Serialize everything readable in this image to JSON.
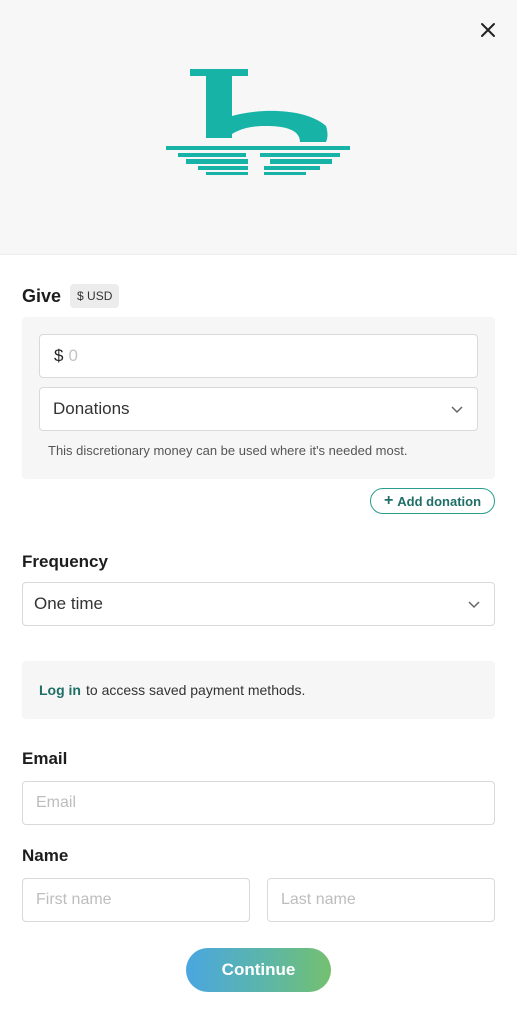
{
  "header": {
    "close_icon": "close-icon",
    "logo_icon": "church-logo",
    "brand_color": "#17b3a6"
  },
  "give": {
    "title": "Give",
    "currency_badge": "$ USD",
    "amount_symbol": "$",
    "amount_placeholder": "0",
    "fund_selected": "Donations",
    "fund_description": "This discretionary money can be used where it's needed most.",
    "add_donation_label": "Add donation"
  },
  "frequency": {
    "label": "Frequency",
    "selected": "One time"
  },
  "login_notice": {
    "link_text": "Log in",
    "text": "to access saved payment methods."
  },
  "email": {
    "label": "Email",
    "placeholder": "Email"
  },
  "name": {
    "label": "Name",
    "first_placeholder": "First name",
    "last_placeholder": "Last name"
  },
  "continue_label": "Continue"
}
